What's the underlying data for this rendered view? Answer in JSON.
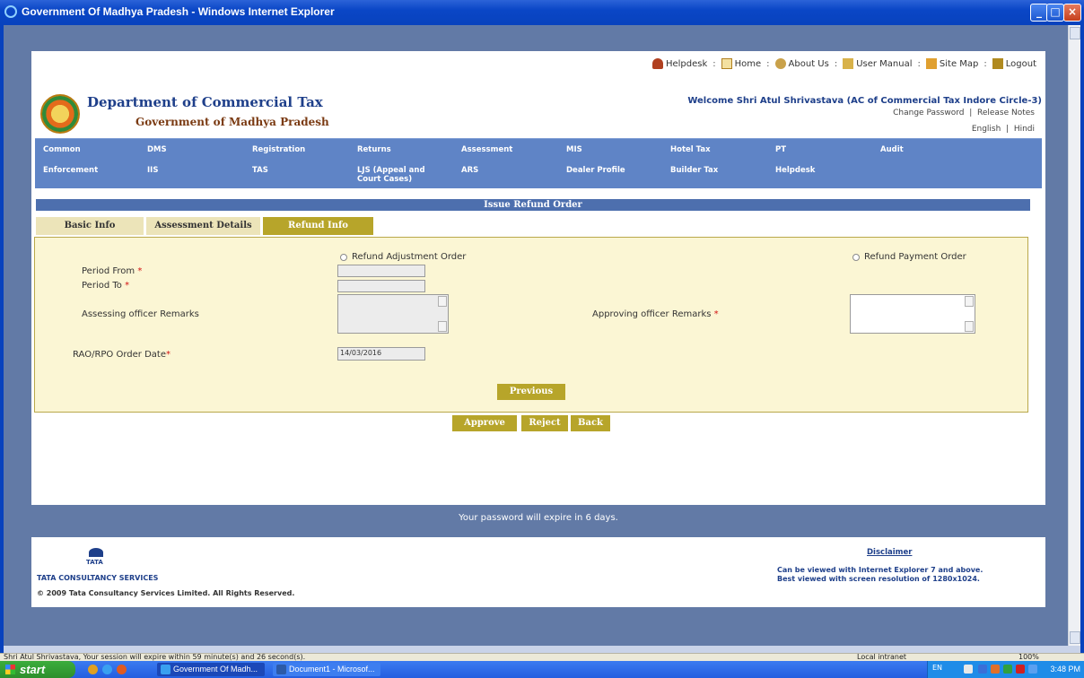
{
  "window": {
    "title": "Government Of Madhya Pradesh - Windows Internet Explorer"
  },
  "header": {
    "toplinks": [
      "Helpdesk",
      "Home",
      "About Us",
      "User Manual",
      "Site Map",
      "Logout"
    ],
    "dept_title": "Department of Commercial Tax",
    "govt_title": "Government of Madhya Pradesh",
    "welcome": "Welcome Shri Atul Shrivastava (AC of Commercial Tax Indore Circle-3)",
    "change_password": "Change Password",
    "release_notes": "Release Notes",
    "english": "English",
    "hindi": "Hindi"
  },
  "menu": {
    "row1": [
      "Common",
      "DMS",
      "Registration",
      "Returns",
      "Assessment",
      "MIS",
      "Hotel Tax",
      "PT",
      "Audit"
    ],
    "row2": [
      "Enforcement",
      "IIS",
      "TAS",
      "LJS (Appeal and Court Cases)",
      "ARS",
      "Dealer Profile",
      "Builder Tax",
      "Helpdesk"
    ]
  },
  "section_title": "Issue Refund Order",
  "tabs": [
    "Basic Info",
    "Assessment Details",
    "Refund Info"
  ],
  "form": {
    "radio_adjustment": "Refund Adjustment Order",
    "radio_payment": "Refund Payment Order",
    "period_from": "Period From",
    "period_to": "Period To",
    "assessing_remarks": "Assessing officer Remarks",
    "approving_remarks": "Approving officer Remarks",
    "order_date_label": "RAO/RPO Order Date",
    "order_date_value": "14/03/2016",
    "required_mark": "*",
    "previous_button": "Previous"
  },
  "actions": {
    "approve": "Approve",
    "reject": "Reject",
    "back": "Back"
  },
  "expire_notice": "Your password will expire in 6 days.",
  "footer": {
    "tata": "TATA",
    "tcs": "TATA CONSULTANCY SERVICES",
    "copyright": "© 2009 Tata Consultancy Services Limited. All Rights Reserved.",
    "disclaimer": "Disclaimer",
    "view_note_1": "Can be viewed with Internet Explorer 7 and above.",
    "view_note_2": "Best viewed with screen resolution of 1280x1024."
  },
  "statusbar": {
    "session": "Shri Atul Shrivastava, Your session will expire within 59 minute(s) and 26 second(s).",
    "zone": "Local intranet",
    "zoom": "100%"
  },
  "taskbar": {
    "start": "start",
    "tasks": [
      "Government Of Madh...",
      "Document1 - Microsof..."
    ],
    "lang": "EN",
    "clock": "3:48 PM"
  },
  "colors": {
    "menu": "#5f84c6",
    "accent": "#b7a52a",
    "form_bg": "#fbf6d4",
    "page_bg": "#627aa6"
  }
}
